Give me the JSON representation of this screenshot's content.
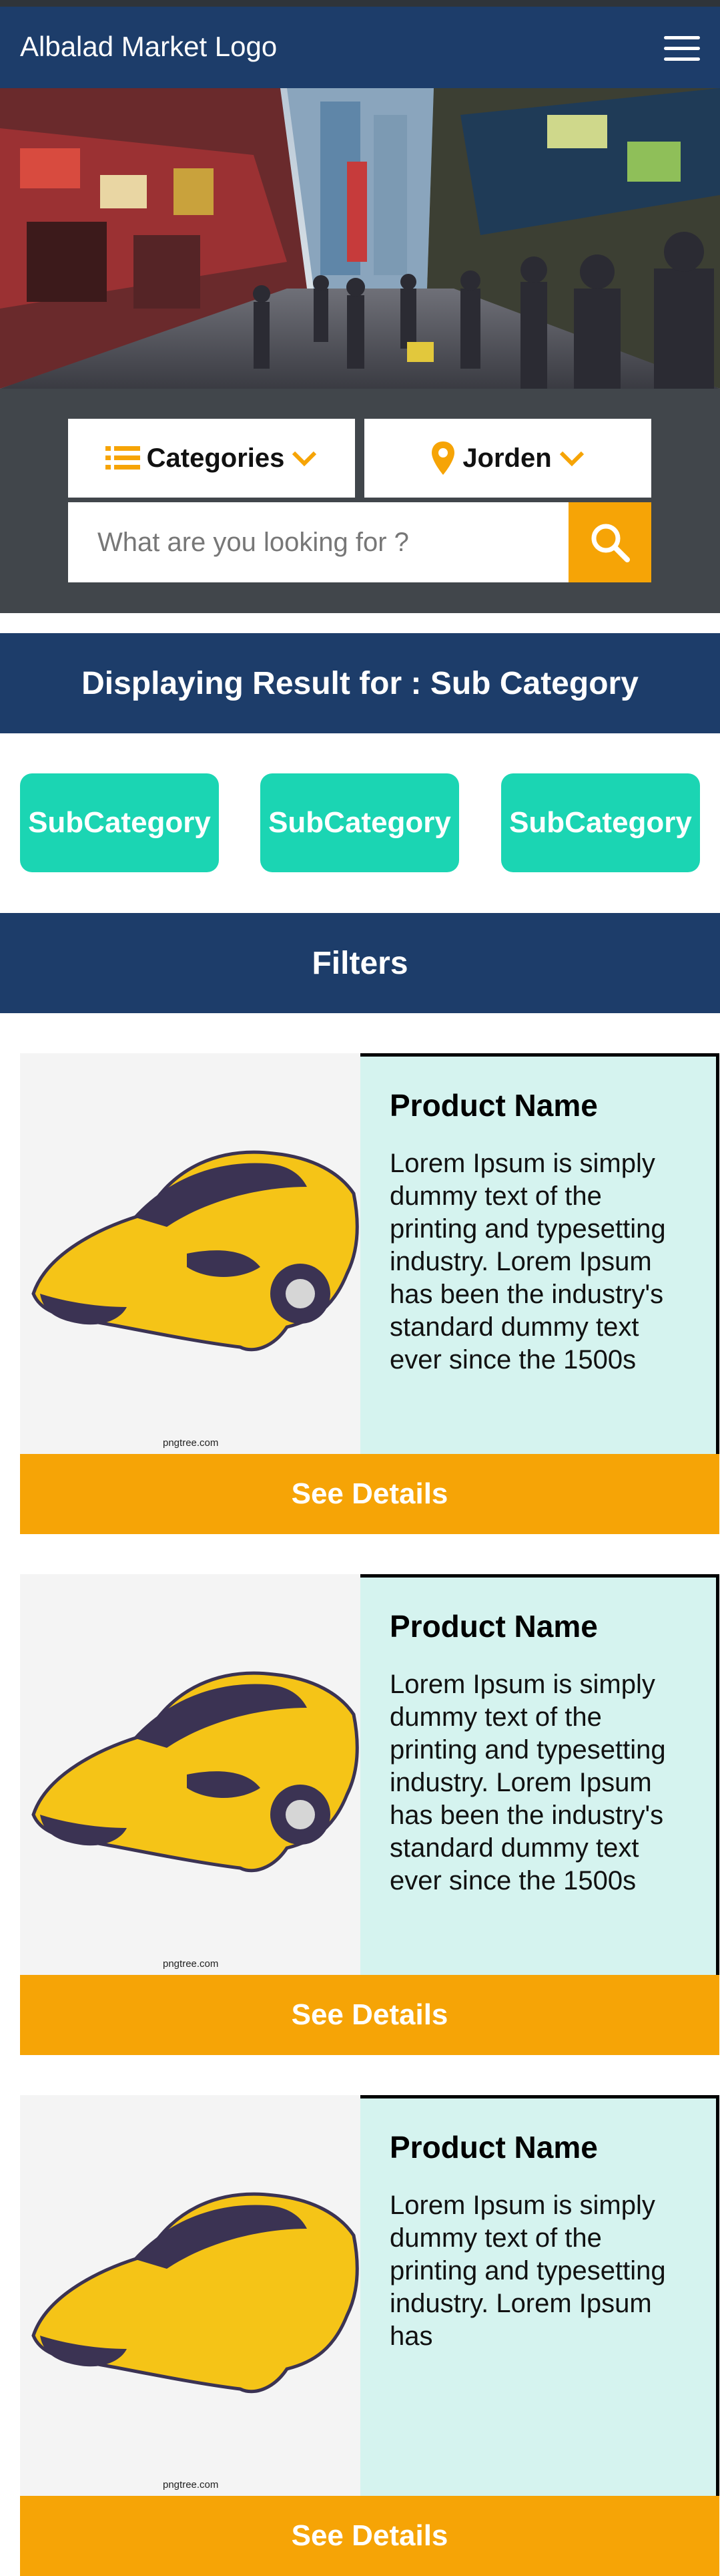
{
  "header": {
    "logo_text": "Albalad Market Logo",
    "menu_icon": "hamburger-menu-icon"
  },
  "search": {
    "categories_label": "Categories",
    "location_label": "Jorden",
    "placeholder": "What are you looking for ?"
  },
  "results": {
    "heading": "Displaying Result for : Sub Category"
  },
  "subcategories": [
    "SubCategory",
    "SubCategory",
    "SubCategory"
  ],
  "filters": {
    "label": "Filters"
  },
  "products": [
    {
      "name": "Product Name",
      "description": "Lorem Ipsum is simply dummy text of the printing and typesetting industry. Lorem Ipsum has been the industry's standard dummy text ever since the 1500s",
      "button": "See Details",
      "watermark": "pngtree.com"
    },
    {
      "name": "Product Name",
      "description": "Lorem Ipsum is simply dummy text of the printing and typesetting industry. Lorem Ipsum has been the industry's standard dummy text ever since the 1500s",
      "button": "See Details",
      "watermark": "pngtree.com"
    },
    {
      "name": "Product Name",
      "description": "Lorem Ipsum is simply dummy text of the printing and typesetting industry. Lorem Ipsum has",
      "button": "See Details",
      "watermark": "pngtree.com"
    }
  ],
  "colors": {
    "navy": "#1d3d6a",
    "accent": "#f6a406",
    "teal": "#1bd5b3",
    "card_bg": "#d5f3ef"
  }
}
